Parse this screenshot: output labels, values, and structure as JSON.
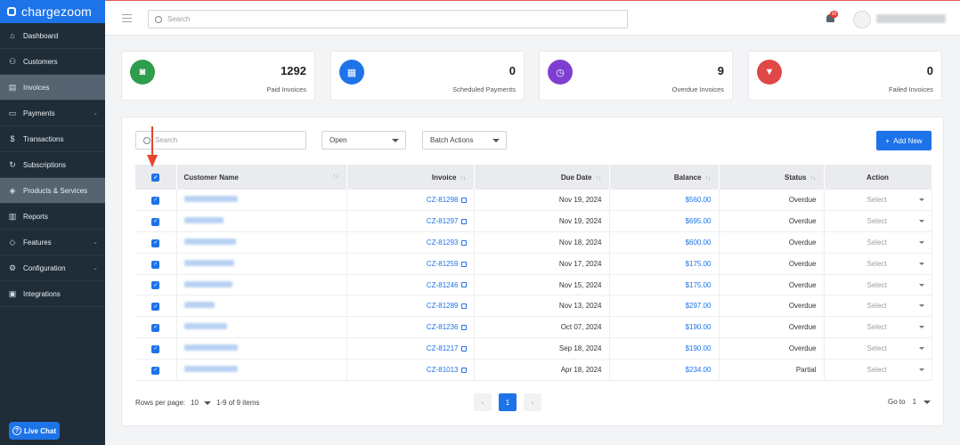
{
  "brand": {
    "name": "chargezoom"
  },
  "sidebar": {
    "items": [
      {
        "label": "Dashboard",
        "icon": "home-icon",
        "active": false,
        "has_submenu": false
      },
      {
        "label": "Customers",
        "icon": "users-icon",
        "active": false,
        "has_submenu": false
      },
      {
        "label": "Invoices",
        "icon": "invoice-icon",
        "active": true,
        "has_submenu": false
      },
      {
        "label": "Payments",
        "icon": "wallet-icon",
        "active": false,
        "has_submenu": true
      },
      {
        "label": "Transactions",
        "icon": "dollar-icon",
        "active": false,
        "has_submenu": false
      },
      {
        "label": "Subscriptions",
        "icon": "refresh-icon",
        "active": false,
        "has_submenu": false
      },
      {
        "label": "Products & Services",
        "icon": "box-icon",
        "active": true,
        "has_submenu": false
      },
      {
        "label": "Reports",
        "icon": "chart-icon",
        "active": false,
        "has_submenu": false
      },
      {
        "label": "Features",
        "icon": "tag-icon",
        "active": false,
        "has_submenu": true
      },
      {
        "label": "Configuration",
        "icon": "gear-icon",
        "active": false,
        "has_submenu": true
      },
      {
        "label": "Integrations",
        "icon": "plug-icon",
        "active": false,
        "has_submenu": false
      }
    ],
    "live_chat": "Live Chat"
  },
  "topbar": {
    "search_placeholder": "Search",
    "notification_count": "20"
  },
  "stats": [
    {
      "value": "1292",
      "label": "Paid Invoices",
      "color": "#2e9d4d",
      "icon": "camera-icon"
    },
    {
      "value": "0",
      "label": "Scheduled Payments",
      "color": "#1d73e8",
      "icon": "calendar-icon"
    },
    {
      "value": "9",
      "label": "Overdue Invoices",
      "color": "#7e3fd0",
      "icon": "clock-icon"
    },
    {
      "value": "0",
      "label": "Failed Invoices",
      "color": "#e04848",
      "icon": "thumbs-down-icon"
    }
  ],
  "toolbar": {
    "search_placeholder": "Search",
    "status_filter": "Open",
    "batch_actions": "Batch Actions",
    "add_new": "Add New"
  },
  "table": {
    "headers": {
      "customer": "Customer Name",
      "invoice": "Invoice",
      "due_date": "Due Date",
      "balance": "Balance",
      "status": "Status",
      "action": "Action"
    },
    "rows": [
      {
        "invoice": "CZ-81298",
        "due_date": "Nov 19, 2024",
        "balance": "$560.00",
        "status": "Overdue",
        "action": "Select"
      },
      {
        "invoice": "CZ-81297",
        "due_date": "Nov 19, 2024",
        "balance": "$695.00",
        "status": "Overdue",
        "action": "Select"
      },
      {
        "invoice": "CZ-81293",
        "due_date": "Nov 18, 2024",
        "balance": "$600.00",
        "status": "Overdue",
        "action": "Select"
      },
      {
        "invoice": "CZ-81259",
        "due_date": "Nov 17, 2024",
        "balance": "$175.00",
        "status": "Overdue",
        "action": "Select"
      },
      {
        "invoice": "CZ-81246",
        "due_date": "Nov 15, 2024",
        "balance": "$175.00",
        "status": "Overdue",
        "action": "Select"
      },
      {
        "invoice": "CZ-81289",
        "due_date": "Nov 13, 2024",
        "balance": "$297.00",
        "status": "Overdue",
        "action": "Select"
      },
      {
        "invoice": "CZ-81236",
        "due_date": "Oct 07, 2024",
        "balance": "$190.00",
        "status": "Overdue",
        "action": "Select"
      },
      {
        "invoice": "CZ-81217",
        "due_date": "Sep 18, 2024",
        "balance": "$190.00",
        "status": "Overdue",
        "action": "Select"
      },
      {
        "invoice": "CZ-81013",
        "due_date": "Apr 18, 2024",
        "balance": "$234.00",
        "status": "Partial",
        "action": "Select"
      }
    ]
  },
  "pagination": {
    "rows_per_page_label": "Rows per page:",
    "rows_per_page": "10",
    "range": "1-9 of 9 items",
    "current_page": "1",
    "goto_label": "Go to",
    "goto_value": "1"
  }
}
